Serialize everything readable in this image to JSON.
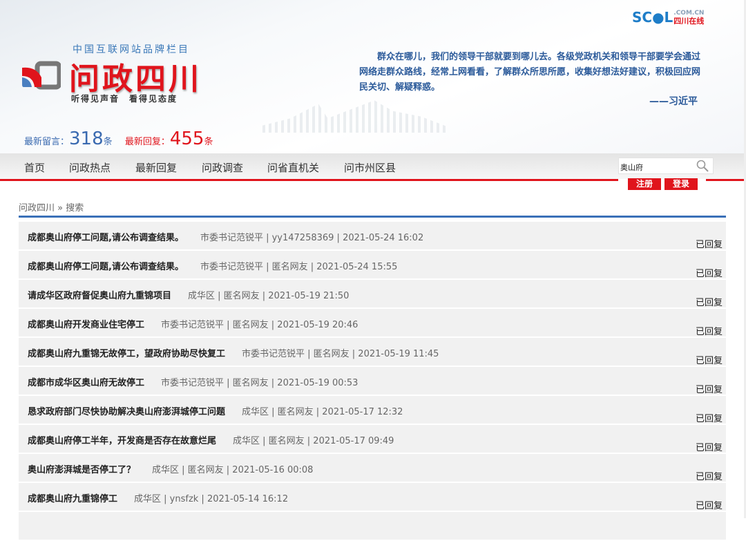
{
  "header": {
    "subtitle": "中国互联网站品牌栏目",
    "logo_title": "问政四川",
    "slogan": "听得见声音　看得见态度",
    "partner_logo": "SC●L",
    "partner_logo_sub": "四川在线",
    "partner_domain": ".COM.CN",
    "quote": "群众在哪儿，我们的领导干部就要到哪儿去。各级党政机关和领导干部要学会通过网络走群众路线，经常上网看看，了解群众所思所愿，收集好想法好建议，积极回应网民关切、解疑释惑。",
    "quote_author": "——习近平",
    "stats": {
      "messages_label": "最新留言：",
      "messages_count": "318",
      "messages_unit": "条",
      "replies_label": "最新回复：",
      "replies_count": "455",
      "replies_unit": "条"
    }
  },
  "nav": {
    "items": [
      "首页",
      "问政热点",
      "最新回复",
      "问政调查",
      "问省直机关",
      "问市州区县"
    ],
    "search_value": "奥山府",
    "register": "注册",
    "login": "登录"
  },
  "breadcrumb": "问政四川 » 搜索",
  "results": [
    {
      "title": "成都奥山府停工问题,请公布调查结果。",
      "meta": "市委书记范锐平 | yy147258369 | 2021-05-24 16:02",
      "status": "已回复"
    },
    {
      "title": "成都奥山府停工问题,请公布调查结果。",
      "meta": "市委书记范锐平 | 匿名网友 | 2021-05-24 15:55",
      "status": "已回复"
    },
    {
      "title": "请成华区政府督促奥山府九重锦项目",
      "meta": "成华区 | 匿名网友 | 2021-05-19 21:50",
      "status": "已回复"
    },
    {
      "title": "成都奥山府开发商业住宅停工",
      "meta": "市委书记范锐平 | 匿名网友 | 2021-05-19 20:46",
      "status": "已回复"
    },
    {
      "title": "成都奥山府九重锦无故停工，望政府协助尽快复工",
      "meta": "市委书记范锐平 | 匿名网友 | 2021-05-19 11:45",
      "status": "已回复"
    },
    {
      "title": "成都市成华区奥山府无故停工",
      "meta": "市委书记范锐平 | 匿名网友 | 2021-05-19 00:53",
      "status": "已回复"
    },
    {
      "title": "恳求政府部门尽快协助解决奥山府澎湃城停工问题",
      "meta": "成华区 | 匿名网友 | 2021-05-17 12:32",
      "status": "已回复"
    },
    {
      "title": "成都奥山府停工半年，开发商是否存在故意烂尾",
      "meta": "成华区 | 匿名网友 | 2021-05-17 09:49",
      "status": "已回复"
    },
    {
      "title": "奥山府澎湃城是否停工了？",
      "meta": "成华区 | 匿名网友 | 2021-05-16 00:08",
      "status": "已回复"
    },
    {
      "title": "成都奥山府九重锦停工",
      "meta": "成华区 | ynsfzk | 2021-05-14 16:12",
      "status": "已回复"
    },
    {
      "title": "",
      "meta": "",
      "status": ""
    }
  ]
}
